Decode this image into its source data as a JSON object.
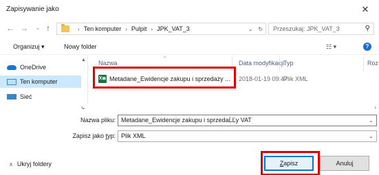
{
  "window": {
    "title": "Zapisywanie jako"
  },
  "address": {
    "segments": [
      "Ten komputer",
      "Pulpit",
      "JPK_VAT_3"
    ],
    "search_placeholder": "Przeszukaj: JPK_VAT_3"
  },
  "toolbar": {
    "organize_label": "Organizuj ▾",
    "new_folder_label": "Nowy folder",
    "view_label": "☷ ▾",
    "help_label": "?"
  },
  "nav": {
    "items": [
      {
        "label": "OneDrive",
        "icon": "cloud-icon"
      },
      {
        "label": "Ten komputer",
        "icon": "computer-icon"
      },
      {
        "label": "Sieć",
        "icon": "network-icon"
      }
    ]
  },
  "files": {
    "columns": [
      "Nazwa",
      "Data modyfikacji",
      "Typ",
      "Roz"
    ],
    "rows": [
      {
        "name": "Metadane_Ewidencje zakupu i sprzedaży ...",
        "date": "2018-01-19 09:47",
        "type": "Plik XML"
      }
    ]
  },
  "form": {
    "filename_label": "Nazwa pliku:",
    "filename_value": "Metadane_Ewidencje zakupu i sprzedaĹĽy VAT",
    "type_label_prefix": "Zapisz jako ",
    "type_label_underlined": "t",
    "type_label_suffix": "yp:",
    "type_value": "Plik XML",
    "hide_folders_label": "Ukryj foldery",
    "save_label_underlined": "Z",
    "save_label_rest": "apisz",
    "cancel_label": "Anuluj"
  },
  "colors": {
    "highlight": "#e00000",
    "accent": "#0078d7",
    "selected_nav": "#cce8ff"
  }
}
